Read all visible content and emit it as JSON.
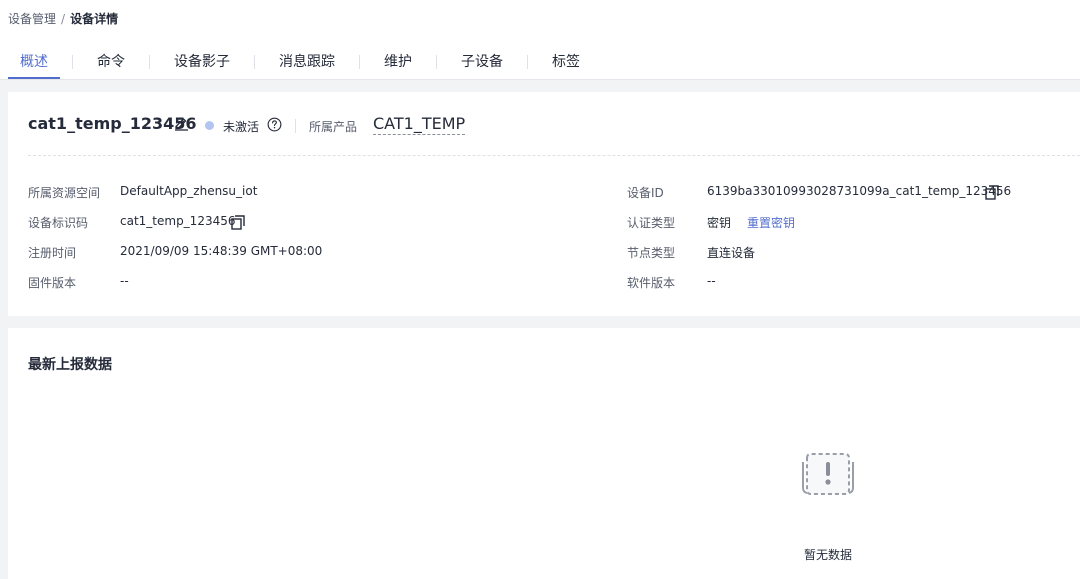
{
  "breadcrumb": {
    "parent": "设备管理",
    "separator": "/",
    "current": "设备详情"
  },
  "tabs": [
    {
      "label": "概述",
      "active": true
    },
    {
      "label": "命令"
    },
    {
      "label": "设备影子"
    },
    {
      "label": "消息跟踪"
    },
    {
      "label": "维护"
    },
    {
      "label": "子设备"
    },
    {
      "label": "标签"
    }
  ],
  "device": {
    "name": "cat1_temp_123456",
    "status": "未激活",
    "status_color": "#b3c4f0",
    "product_label": "所属产品",
    "product_value": "CAT1_TEMP"
  },
  "details": {
    "resource_space_label": "所属资源空间",
    "resource_space_value": "DefaultApp_zhensu_iot",
    "node_id_label": "设备标识码",
    "node_id_value": "cat1_temp_123456",
    "reg_time_label": "注册时间",
    "reg_time_value": "2021/09/09 15:48:39 GMT+08:00",
    "fw_label": "固件版本",
    "fw_value": "--",
    "device_id_label": "设备ID",
    "device_id_value": "6139ba33010993028731099a_cat1_temp_123456",
    "auth_label": "认证类型",
    "auth_value": "密钥",
    "reset_key_label": "重置密钥",
    "node_type_label": "节点类型",
    "node_type_value": "直连设备",
    "sw_label": "软件版本",
    "sw_value": "--"
  },
  "latest_data": {
    "title": "最新上报数据",
    "empty_text": "暂无数据"
  },
  "icons": {
    "edit": "edit-icon",
    "help": "question-circle-icon",
    "copy": "copy-icon",
    "empty": "empty-box-icon"
  },
  "colors": {
    "accent": "#526ecc",
    "text": "#252b3a",
    "label": "#575d6c",
    "background": "#f2f3f5"
  }
}
